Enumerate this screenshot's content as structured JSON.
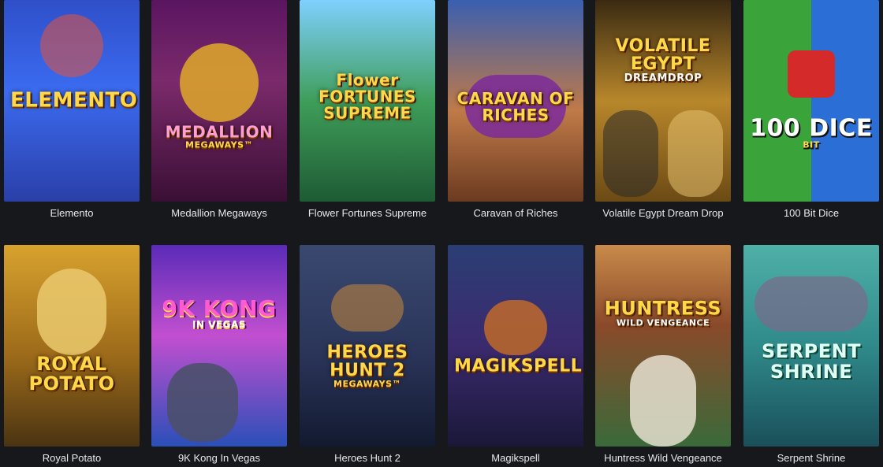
{
  "games": [
    {
      "title": "Elemento",
      "logo": "ELEMENTO",
      "logo_color": "#ffd84a"
    },
    {
      "title": "Medallion Megaways",
      "logo": "MEDALLION",
      "logo_sub": "MEGAWAYS™",
      "logo_color": "#ff9fd0"
    },
    {
      "title": "Flower Fortunes Supreme",
      "logo": "Flower FORTUNES SUPREME",
      "logo_color": "#ffe24a"
    },
    {
      "title": "Caravan of Riches",
      "logo": "CARAVAN OF RICHES",
      "logo_color": "#ffd84a"
    },
    {
      "title": "Volatile Egypt Dream Drop",
      "logo": "VOLATILE EGYPT",
      "logo_sub": "DREAMDROP",
      "logo_color": "#ffe27a"
    },
    {
      "title": "100 Bit Dice",
      "logo": "100 DICE",
      "logo_sub": "BIT",
      "logo_color": "#ffffff"
    },
    {
      "title": "Royal Potato",
      "logo": "ROYAL POTATO",
      "logo_color": "#ffe24a"
    },
    {
      "title": "9K Kong In Vegas",
      "logo": "9K KONG",
      "logo_sub": "IN VEGAS",
      "logo_color": "#ffd84a"
    },
    {
      "title": "Heroes Hunt 2",
      "logo": "HEROES HUNT 2",
      "logo_sub": "MEGAWAYS™",
      "logo_color": "#ffd84a"
    },
    {
      "title": "Magikspell",
      "logo": "MAGIKSPELL",
      "logo_color": "#ffe24a"
    },
    {
      "title": "Huntress Wild Vengeance",
      "logo": "HUNTRESS",
      "logo_sub": "WILD VENGEANCE",
      "logo_color": "#ffe27a"
    },
    {
      "title": "Serpent Shrine",
      "logo": "SERPENT SHRINE",
      "logo_color": "#dffff4"
    }
  ]
}
